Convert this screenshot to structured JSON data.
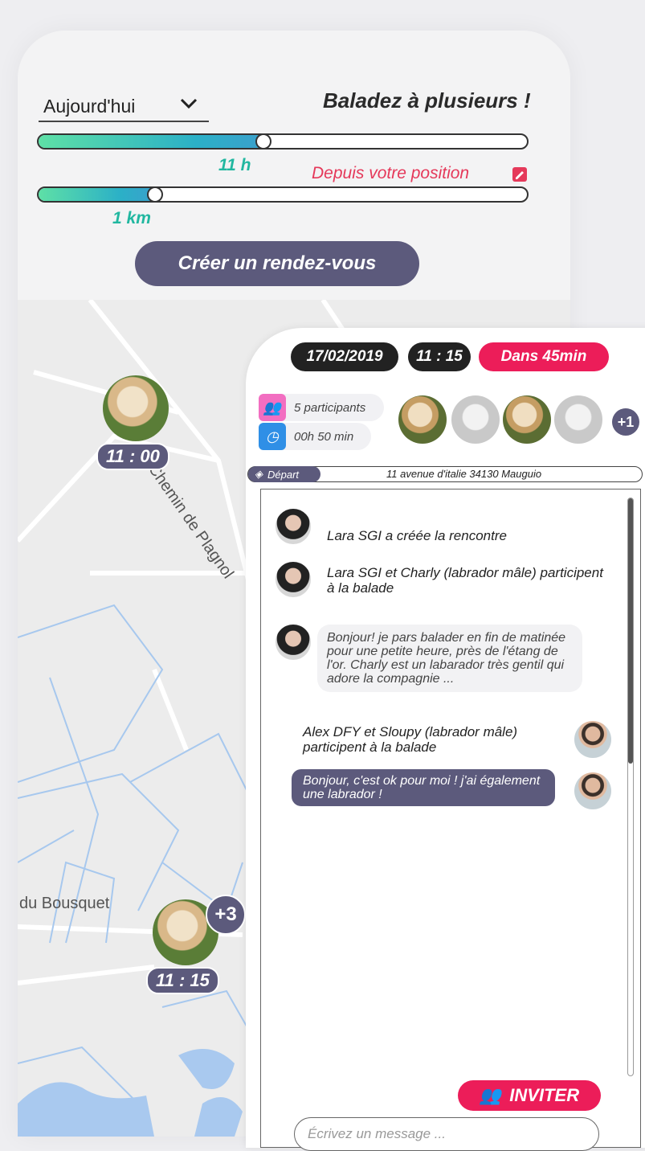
{
  "filters": {
    "day": "Aujourd'hui",
    "headline": "Baladez à plusieurs !",
    "time_label": "11 h",
    "time_fraction": 0.46,
    "distance_label": "1 km",
    "distance_fraction": 0.24,
    "position_link": "Depuis votre position",
    "create_button": "Créer un rendez-vous"
  },
  "map": {
    "street_1": "Chemin de Plagnol",
    "street_2": "du Bousquet",
    "pin_1_time": "11 : 00",
    "pin_2_time": "11 : 15",
    "pin_2_extra": "+3"
  },
  "event": {
    "date": "17/02/2019",
    "time": "11 : 15",
    "countdown": "Dans 45min",
    "participants": "5 participants",
    "duration": "00h 50 min",
    "more_participants": "+1",
    "depart_label": "Départ",
    "address": "11 avenue d'italie 34130 Mauguio"
  },
  "chat": {
    "sys_1": "Lara SGI a créée la rencontre",
    "sys_2": "Lara SGI et Charly (labrador mâle) participent à la balade",
    "msg_1": "Bonjour! je pars balader en fin de matinée pour une petite heure, près de l'étang de l'or. Charly est un labarador très gentil qui adore la compagnie ...",
    "sys_3": "Alex DFY et Sloupy (labrador mâle) participent à la balade",
    "msg_2": "Bonjour, c'est ok pour moi ! j'ai également une labrador !",
    "invite_button": "INVITER",
    "input_placeholder": "Écrivez un message ..."
  },
  "colors": {
    "accent": "#5c5a7c",
    "red": "#ec1d59",
    "teal": "#21b7a0"
  }
}
